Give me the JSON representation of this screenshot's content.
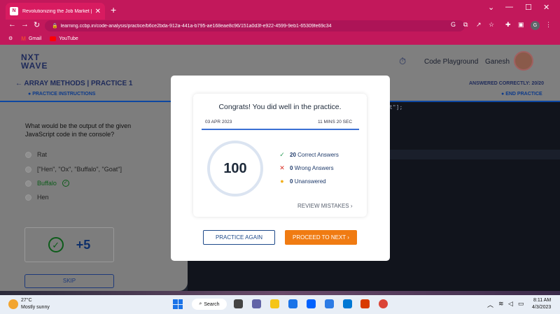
{
  "browser": {
    "tab_title": "Revolutionizing the Job Market | ",
    "tab_close": "✕",
    "new_tab": "+",
    "url": "learning.ccbp.in/code-analysis/practice/b6ce2bda-912a-441a-b795-ae168eae8c96/151a0d3f-e922-4599-9eb1-65309fe69c34",
    "profile_initial": "G",
    "bookmarks": [
      {
        "label": "Gmail",
        "icon": "gmail-icon"
      },
      {
        "label": "YouTube",
        "icon": "youtube-icon"
      }
    ]
  },
  "header": {
    "logo_line1": "NXT",
    "logo_line2": "WAVE",
    "code_playground": "Code Playground",
    "user_name": "Ganesh"
  },
  "subheader": {
    "title": "ARRAY METHODS | PRACTICE 1",
    "instructions": "PRACTICE INSTRUCTIONS",
    "answered": "ANSWERED CORRECTLY: 20/20",
    "end_practice": "END PRACTICE"
  },
  "question": {
    "text": "What would be the output of the given JavaScript code in the console?",
    "options": [
      {
        "label": "Rat"
      },
      {
        "label": "[\"Hen\", \"Ox\", \"Buffalo\", \"Goat\"]"
      },
      {
        "label": "Buffalo",
        "correct": true
      },
      {
        "label": "Hen"
      }
    ],
    "score": "+5",
    "skip": "SKIP"
  },
  "editor": {
    "visible_code": "t\"];"
  },
  "modal": {
    "heading": "Congrats! You did well in the practice.",
    "date": "03 APR 2023",
    "duration": "11 MINS 20 SEC",
    "score": "100",
    "stats": [
      {
        "count": "20",
        "label": "Correct Answers",
        "icon": "check-icon",
        "color": "#2e9e5b"
      },
      {
        "count": "0",
        "label": "Wrong Answers",
        "icon": "cross-icon",
        "color": "#d93025"
      },
      {
        "count": "0",
        "label": "Unanswered",
        "icon": "dot-icon",
        "color": "#f2b01e"
      }
    ],
    "review_mistakes": "REVIEW MISTAKES",
    "practice_again": "PRACTICE AGAIN",
    "proceed_next": "PROCEED TO NEXT"
  },
  "taskbar": {
    "temperature": "27°C",
    "weather": "Mostly sunny",
    "search": "Search",
    "time": "8:11 AM",
    "date": "4/3/2023"
  },
  "colors": {
    "browser_chrome": "#c2185b",
    "accent_blue": "#3b6fd4",
    "proceed_orange": "#f07b12",
    "correct_green": "#0d5c1a"
  }
}
